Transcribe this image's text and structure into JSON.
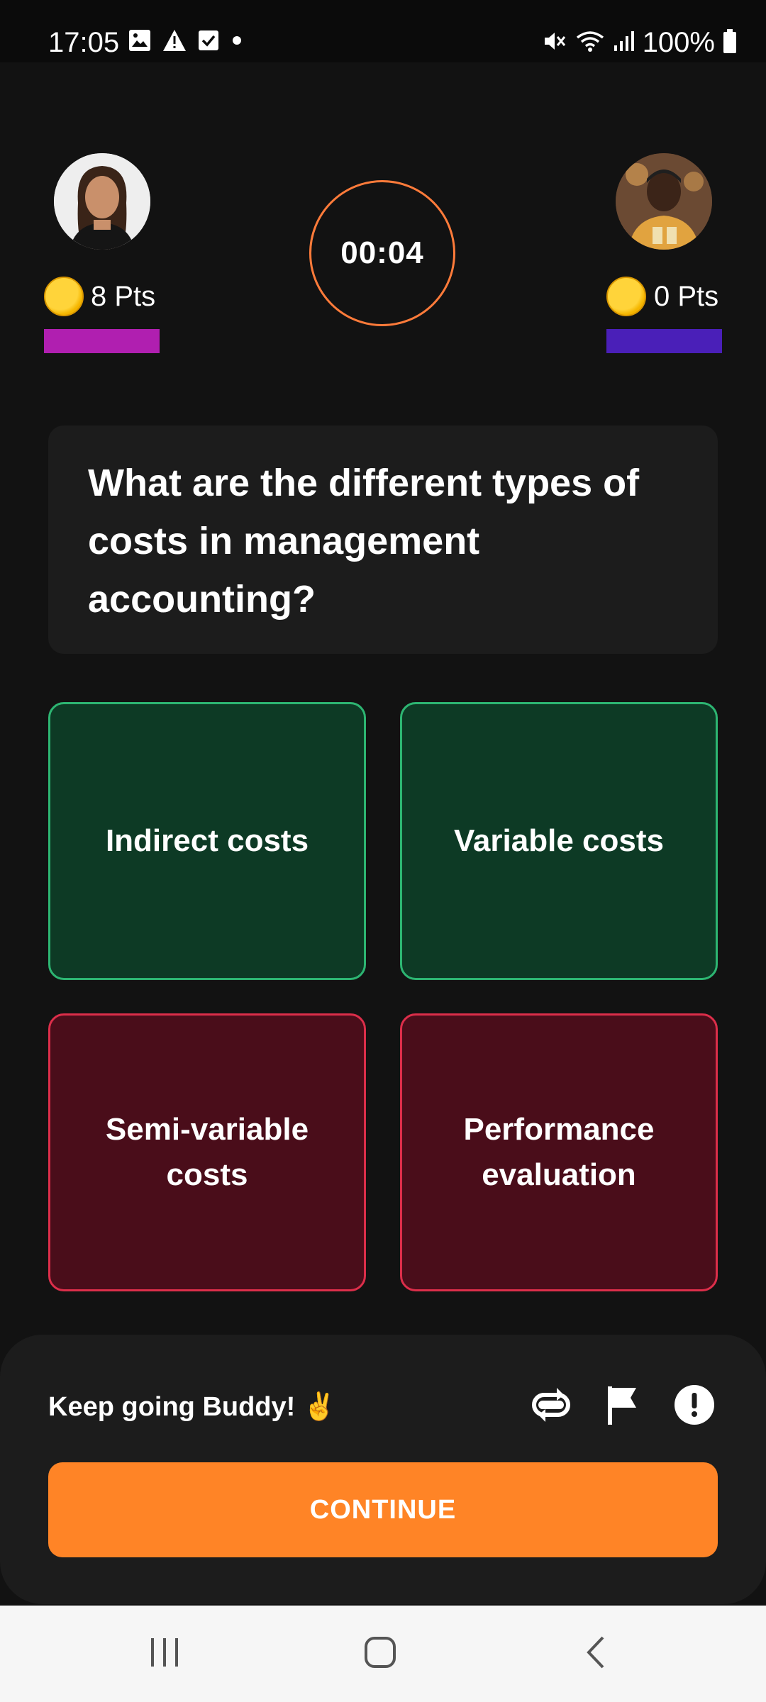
{
  "status_bar": {
    "time": "17:05",
    "battery": "100%",
    "left_icons": [
      "gallery-icon",
      "warning-icon",
      "checkbox-icon",
      "dot-icon"
    ],
    "right_icons": [
      "mute-icon",
      "wifi-icon",
      "signal-icon",
      "battery-icon"
    ]
  },
  "players": {
    "left": {
      "points": "8 Pts",
      "bar_color": "#b01fb0"
    },
    "right": {
      "points": "0 Pts",
      "bar_color": "#4a1fb8"
    }
  },
  "timer": "00:04",
  "question": "What are the different types of costs in management accounting?",
  "answers": [
    {
      "label": "Indirect costs",
      "state": "correct"
    },
    {
      "label": "Variable costs",
      "state": "correct"
    },
    {
      "label": "Semi-variable costs",
      "state": "wrong"
    },
    {
      "label": "Performance evaluation",
      "state": "wrong"
    }
  ],
  "footer": {
    "encouragement": "Keep going Buddy! ✌️",
    "continue_label": "CONTINUE",
    "icons": [
      "repeat-icon",
      "flag-icon",
      "report-icon"
    ]
  },
  "colors": {
    "accent": "#ff8426",
    "correct_bg": "#0d3a25",
    "correct_border": "#2db572",
    "wrong_bg": "#4a0d1a",
    "wrong_border": "#dc2e4a",
    "timer_ring": "#ff7b3a"
  }
}
